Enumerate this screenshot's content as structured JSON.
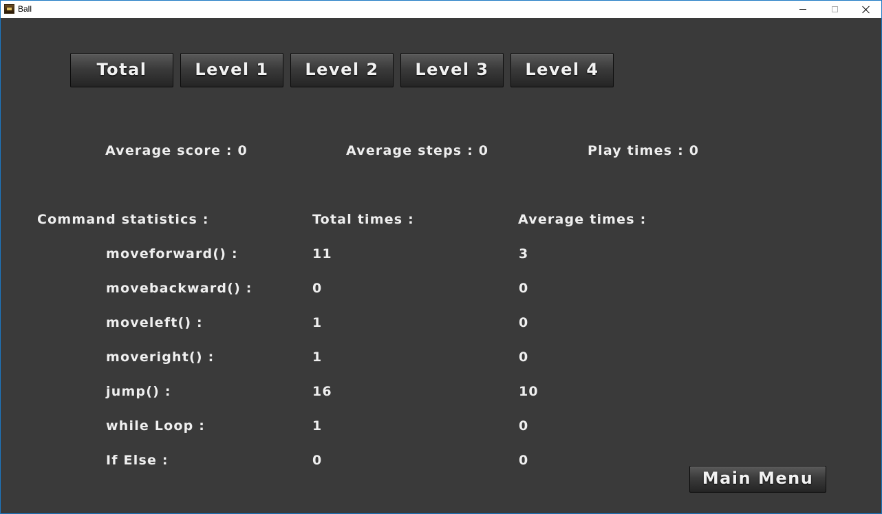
{
  "window": {
    "title": "Ball"
  },
  "tabs": [
    {
      "label": "Total"
    },
    {
      "label": "Level 1"
    },
    {
      "label": "Level 2"
    },
    {
      "label": "Level 3"
    },
    {
      "label": "Level 4"
    }
  ],
  "summary": {
    "average_score": "Average score : 0",
    "average_steps": "Average steps : 0",
    "play_times": "Play times : 0"
  },
  "command_table": {
    "header": {
      "command": "Command statistics :",
      "total": "Total times :",
      "average": "Average times :"
    },
    "rows": [
      {
        "command": "moveforward() :",
        "total": "11",
        "average": "3"
      },
      {
        "command": "movebackward() :",
        "total": "0",
        "average": "0"
      },
      {
        "command": "moveleft() :",
        "total": "1",
        "average": "0"
      },
      {
        "command": "moveright() :",
        "total": "1",
        "average": "0"
      },
      {
        "command": "jump() :",
        "total": "16",
        "average": "10"
      },
      {
        "command": "while Loop :",
        "total": "1",
        "average": "0"
      },
      {
        "command": "If Else :",
        "total": "0",
        "average": "0"
      }
    ]
  },
  "main_menu_label": "Main Menu",
  "colors": {
    "background": "#3a3a3a",
    "text": "#efefef",
    "window_border": "#1b78c4"
  }
}
